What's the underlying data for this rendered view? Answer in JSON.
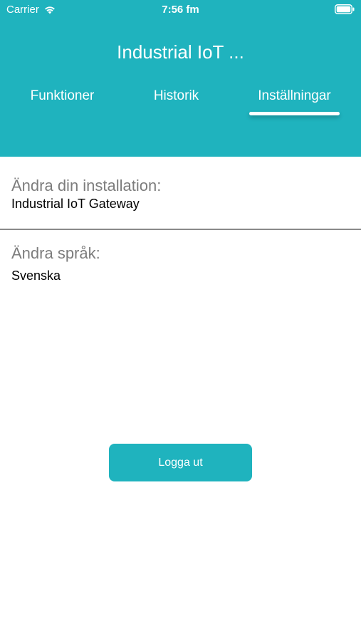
{
  "status_bar": {
    "carrier": "Carrier",
    "time": "7:56 fm",
    "wifi_icon": "wifi-icon",
    "battery_icon": "battery-icon"
  },
  "header": {
    "title": "Industrial IoT ...",
    "background_color": "#1fb3be"
  },
  "tabs": [
    {
      "label": "Funktioner",
      "selected": false
    },
    {
      "label": "Historik",
      "selected": false
    },
    {
      "label": "Inställningar",
      "selected": true
    }
  ],
  "settings": {
    "installation": {
      "label": "Ändra din installation:",
      "value": "Industrial IoT Gateway"
    },
    "language": {
      "label": "Ändra språk:",
      "value": "Svenska"
    }
  },
  "logout_button": {
    "label": "Logga ut",
    "color": "#1fb3be"
  }
}
